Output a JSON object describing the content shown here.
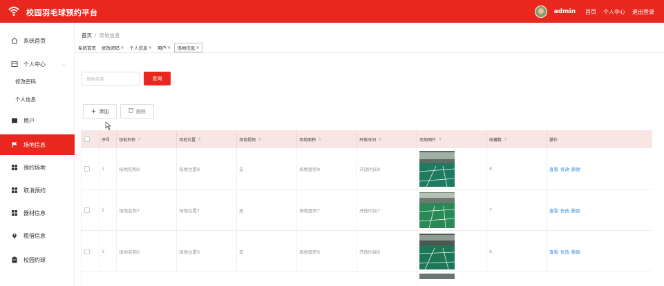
{
  "header": {
    "brand": "校园羽毛球预约平台",
    "username": "admin",
    "links": [
      "首页",
      "个人中心",
      "退出登录"
    ]
  },
  "sidebar": {
    "items": [
      {
        "label": "系统首页",
        "icon": "home-icon"
      },
      {
        "label": "个人中心",
        "icon": "user-center-icon",
        "expanded": true
      },
      {
        "label": "修改密码",
        "sub": true
      },
      {
        "label": "个人信息",
        "sub": true
      },
      {
        "label": "用户",
        "icon": "user-icon"
      },
      {
        "label": "场地信息",
        "icon": "flag-icon",
        "active": true
      },
      {
        "label": "预约场地",
        "icon": "grid-icon"
      },
      {
        "label": "取消预约",
        "icon": "grid-icon"
      },
      {
        "label": "器材信息",
        "icon": "grid-icon"
      },
      {
        "label": "租借信息",
        "icon": "location-icon"
      },
      {
        "label": "校园约球",
        "icon": "clipboard-icon"
      }
    ]
  },
  "breadcrumb": {
    "home": "首页",
    "sep": "/",
    "current": "场地信息"
  },
  "tabs": [
    {
      "label": "系统首页",
      "closable": false
    },
    {
      "label": "修改密码",
      "closable": true
    },
    {
      "label": "个人信息",
      "closable": true
    },
    {
      "label": "用户",
      "closable": true
    },
    {
      "label": "场地信息",
      "closable": true,
      "active": true
    }
  ],
  "search": {
    "placeholder": "场地名称",
    "button": "查询"
  },
  "actions": {
    "add": "添加",
    "delete": "删除"
  },
  "table": {
    "columns": [
      "序号",
      "场地名称",
      "场地位置",
      "场地视频",
      "场地面积",
      "开放时间",
      "场地图片",
      "收藏数",
      "操作"
    ],
    "rows": [
      {
        "index": "1",
        "name": "场地名称8",
        "location": "场地位置8",
        "video": "无",
        "area": "场地面积8",
        "open_time": "开放时间8",
        "favorites": "8"
      },
      {
        "index": "2",
        "name": "场地名称7",
        "location": "场地位置7",
        "video": "无",
        "area": "场地面积7",
        "open_time": "开放时间7",
        "favorites": "7"
      },
      {
        "index": "3",
        "name": "场地名称6",
        "location": "场地位置6",
        "video": "无",
        "area": "场地面积6",
        "open_time": "开放时间6",
        "favorites": "6"
      }
    ],
    "ops": [
      "查看",
      "修改",
      "删除"
    ]
  },
  "colors": {
    "accent": "#e8281e",
    "header_row": "#f8e6e4",
    "link": "#3b8ee0"
  }
}
